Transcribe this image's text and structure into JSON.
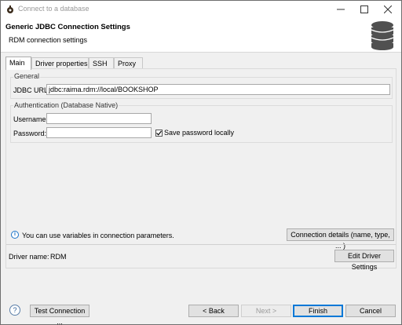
{
  "window": {
    "title": "Connect to a database",
    "minimize_icon": "minimize-icon",
    "maximize_icon": "maximize-icon",
    "close_icon": "close-icon"
  },
  "header": {
    "title": "Generic JDBC Connection Settings",
    "subtitle": "RDM connection settings",
    "icon": "database-icon"
  },
  "tabs": [
    {
      "label": "Main",
      "active": true
    },
    {
      "label": "Driver properties",
      "active": false
    },
    {
      "label": "SSH",
      "active": false
    },
    {
      "label": "Proxy",
      "active": false
    }
  ],
  "general": {
    "legend": "General",
    "jdbc_url_label": "JDBC URL:",
    "jdbc_url_value": "jdbc:raima.rdm://local/BOOKSHOP"
  },
  "auth": {
    "legend": "Authentication (Database Native)",
    "username_label": "Username:",
    "username_value": "",
    "password_label": "Password:",
    "password_value": "",
    "save_password_label": "Save password locally",
    "save_password_checked": true
  },
  "info": {
    "text": "You can use variables in connection parameters.",
    "connection_details_button": "Connection details (name, type, ... )"
  },
  "driver": {
    "label": "Driver name:",
    "value": "RDM",
    "edit_button": "Edit Driver Settings"
  },
  "footer": {
    "test_connection": "Test Connection ...",
    "back": "< Back",
    "next": "Next >",
    "finish": "Finish",
    "cancel": "Cancel"
  },
  "colors": {
    "accent": "#0078d7",
    "info": "#1a73c8",
    "window_bg": "#f0f0f0"
  }
}
